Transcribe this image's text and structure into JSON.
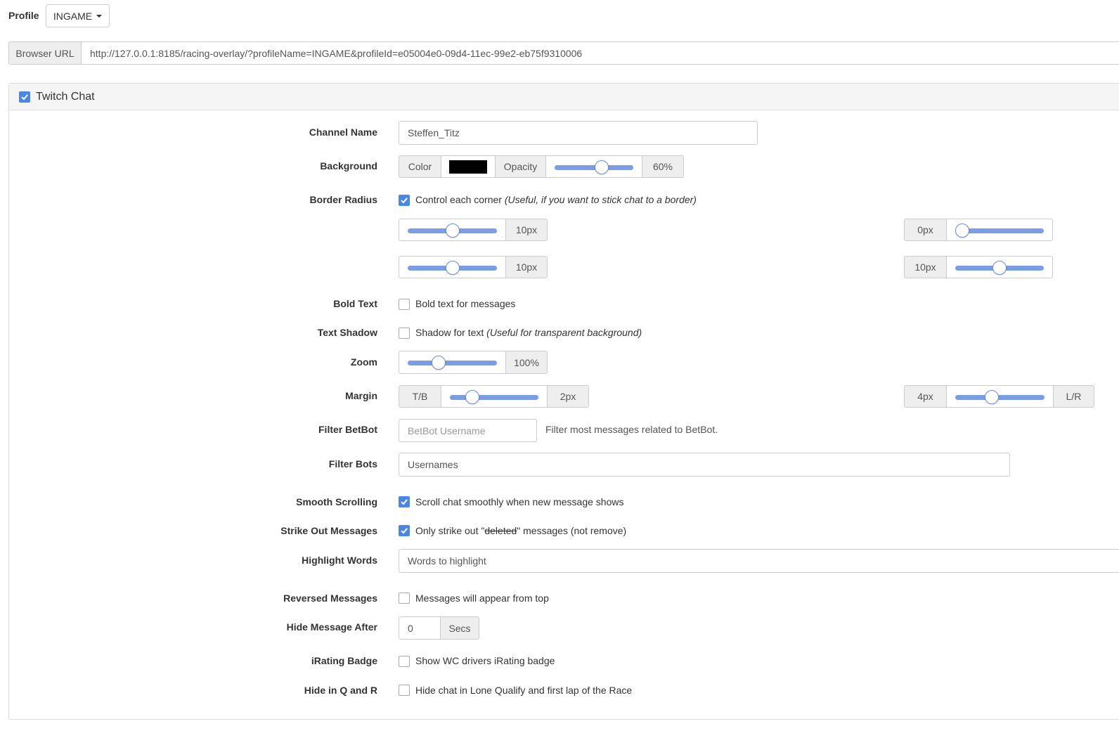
{
  "header": {
    "profile_label": "Profile",
    "profile_value": "INGAME",
    "browser_url_label": "Browser URL",
    "browser_url": "http://127.0.0.1:8185/racing-overlay/?profileName=INGAME&profileId=e05004e0-09d4-11ec-99e2-eb75f9310006"
  },
  "panel": {
    "title": "Twitch Chat",
    "enabled": true
  },
  "fields": {
    "channel_name": {
      "label": "Channel Name",
      "value": "Steffen_Titz"
    },
    "background": {
      "label": "Background",
      "color_label": "Color",
      "color_value": "#000000",
      "opacity_label": "Opacity",
      "opacity_value": "60%",
      "opacity_pct": 60
    },
    "border_radius": {
      "label": "Border Radius",
      "checkbox_text": "Control each corner",
      "checkbox_hint": "(Useful, if you want to stick chat to a border)",
      "checked": true,
      "top_left": "10px",
      "top_left_pct": 50,
      "top_right": "0px",
      "top_right_pct": 0,
      "bottom_left": "10px",
      "bottom_left_pct": 50,
      "bottom_right": "10px",
      "bottom_right_pct": 50
    },
    "bold_text": {
      "label": "Bold Text",
      "checkbox_text": "Bold text for messages",
      "checked": false
    },
    "text_shadow": {
      "label": "Text Shadow",
      "checkbox_text": "Shadow for text",
      "checkbox_hint": "(Useful for transparent background)",
      "checked": false
    },
    "zoom": {
      "label": "Zoom",
      "value": "100%",
      "pct": 33
    },
    "margin": {
      "label": "Margin",
      "tb_label": "T/B",
      "tb_value": "2px",
      "tb_pct": 25,
      "lr_label": "L/R",
      "lr_value": "4px",
      "lr_pct": 40
    },
    "filter_betbot": {
      "label": "Filter BetBot",
      "placeholder": "BetBot Username",
      "help": "Filter most messages related to BetBot."
    },
    "filter_bots": {
      "label": "Filter Bots",
      "placeholder": "Usernames"
    },
    "smooth_scrolling": {
      "label": "Smooth Scrolling",
      "checkbox_text": "Scroll chat smoothly when new message shows",
      "checked": true
    },
    "strike_out": {
      "label": "Strike Out Messages",
      "text_before": "Only strike out \"",
      "text_strike": "deleted",
      "text_after": "\" messages (not remove)",
      "checked": true
    },
    "highlight_words": {
      "label": "Highlight Words",
      "placeholder": "Words to highlight"
    },
    "reversed": {
      "label": "Reversed Messages",
      "checkbox_text": "Messages will appear from top",
      "checked": false
    },
    "hide_after": {
      "label": "Hide Message After",
      "value": "0",
      "unit": "Secs"
    },
    "irating": {
      "label": "iRating Badge",
      "checkbox_text": "Show WC drivers iRating badge",
      "checked": false
    },
    "hide_qr": {
      "label": "Hide in Q and R",
      "checkbox_text": "Hide chat in Lone Qualify and first lap of the Race",
      "checked": false
    }
  },
  "colors": {
    "accent": "#4a86e8",
    "slider_track": "#7a9de3"
  }
}
